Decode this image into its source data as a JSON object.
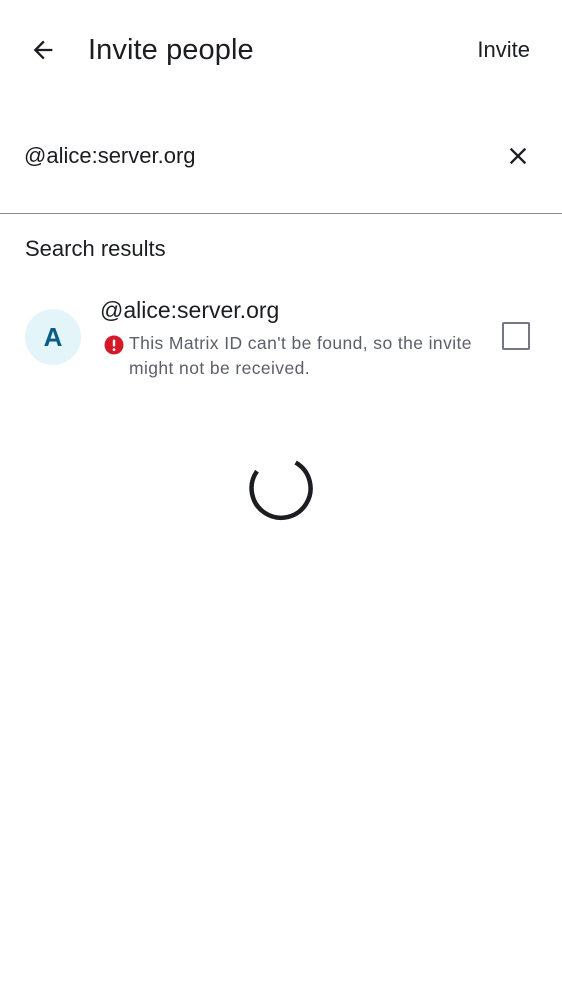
{
  "header": {
    "title": "Invite people",
    "invite_label": "Invite"
  },
  "search": {
    "value": "@alice:server.org"
  },
  "results": {
    "section_title": "Search results",
    "items": [
      {
        "avatar_initial": "A",
        "user_id": "@alice:server.org",
        "warning": "This Matrix ID can't be found, so the invite might not be received.",
        "selected": false
      }
    ]
  },
  "colors": {
    "avatar_bg": "#e3f5f8",
    "avatar_text": "#0a5e86",
    "warning_icon": "#d51928"
  },
  "icons": [
    "arrow-back-icon",
    "close-icon",
    "error-icon",
    "loading-spinner"
  ]
}
